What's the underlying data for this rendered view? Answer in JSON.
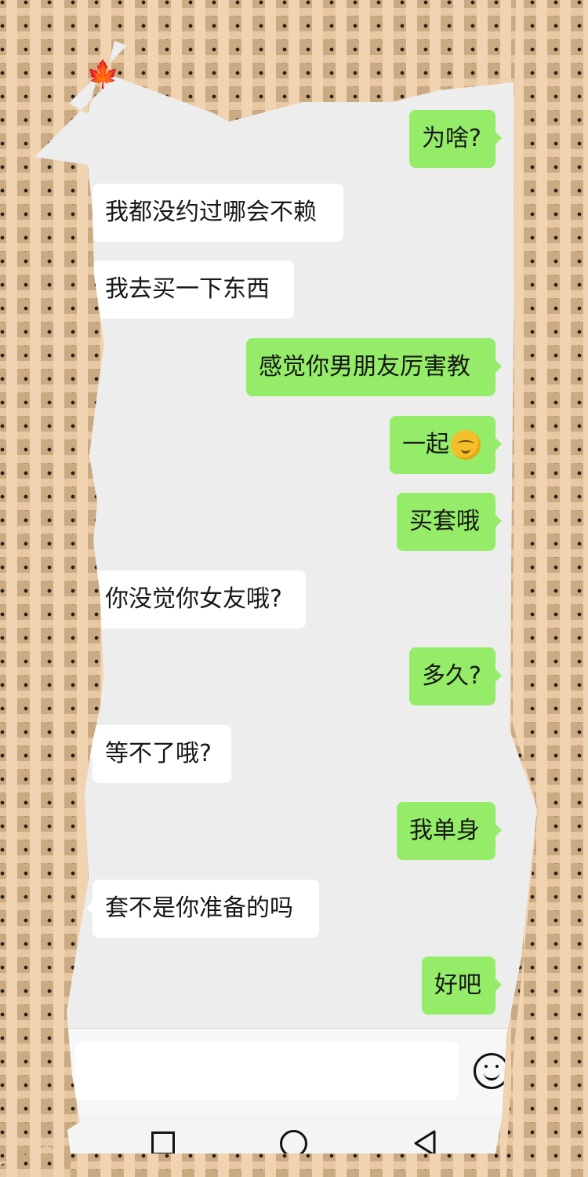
{
  "header": {
    "emoji": "🍁"
  },
  "messages": [
    {
      "side": "right",
      "text": "为啥?"
    },
    {
      "side": "left",
      "text": "我都没约过哪会不赖"
    },
    {
      "side": "left",
      "text": "我去买一下东西"
    },
    {
      "side": "right",
      "text": "感觉你男朋友厉害教"
    },
    {
      "side": "right",
      "text": "一起"
    },
    {
      "side": "right",
      "text": "买套哦"
    },
    {
      "side": "left",
      "text": "你没觉你女友哦?"
    },
    {
      "side": "right",
      "text": "多久?"
    },
    {
      "side": "left",
      "text": "等不了哦?"
    },
    {
      "side": "right",
      "text": "我单身"
    },
    {
      "side": "left",
      "text": "套不是你准备的吗"
    },
    {
      "side": "right",
      "text": "好吧"
    }
  ],
  "icons": {
    "emoji_button": "emoji-icon",
    "nav_recent": "square-icon",
    "nav_home": "circle-icon",
    "nav_back": "triangle-back-icon"
  },
  "colors": {
    "sent_bubble": "#95ec69",
    "received_bubble": "#ffffff",
    "chat_background": "#ededed"
  }
}
